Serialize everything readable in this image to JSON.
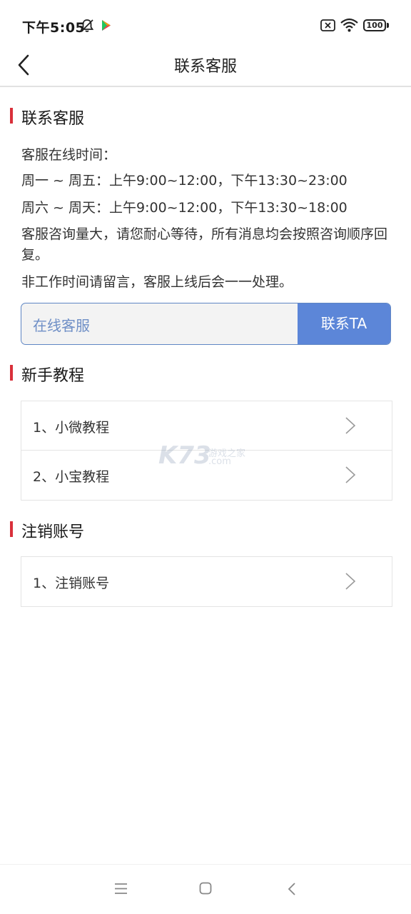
{
  "status_bar": {
    "time": "下午5:05",
    "battery": "100",
    "icons": [
      "bell-off-icon",
      "play-store-icon",
      "sim-error-icon",
      "wifi-icon",
      "battery-icon"
    ]
  },
  "nav": {
    "title": "联系客服",
    "back_icon": "chevron-left-icon"
  },
  "contact_section": {
    "title": "联系客服",
    "lines": [
      "客服在线时间：",
      "周一 ~ 周五：上午9:00~12:00，下午13:30~23:00",
      "周六 ~ 周天：上午9:00~12:00，下午13:30~18:00",
      "客服咨询量大，请您耐心等待，所有消息均会按照咨询顺序回复。",
      "非工作时间请留言，客服上线后会一一处理。"
    ],
    "service_label": "在线客服",
    "contact_button": "联系TA"
  },
  "tutorial_section": {
    "title": "新手教程",
    "items": [
      {
        "label": "1、小微教程"
      },
      {
        "label": "2、小宝教程"
      }
    ]
  },
  "account_section": {
    "title": "注销账号",
    "items": [
      {
        "label": "1、注销账号"
      }
    ]
  },
  "watermark": {
    "logo": "K73",
    "cn": "游戏之家",
    "domain": ".com"
  },
  "colors": {
    "accent_red": "#d9303a",
    "button_blue": "#5c86d8",
    "label_blue": "#6f8fc6"
  }
}
